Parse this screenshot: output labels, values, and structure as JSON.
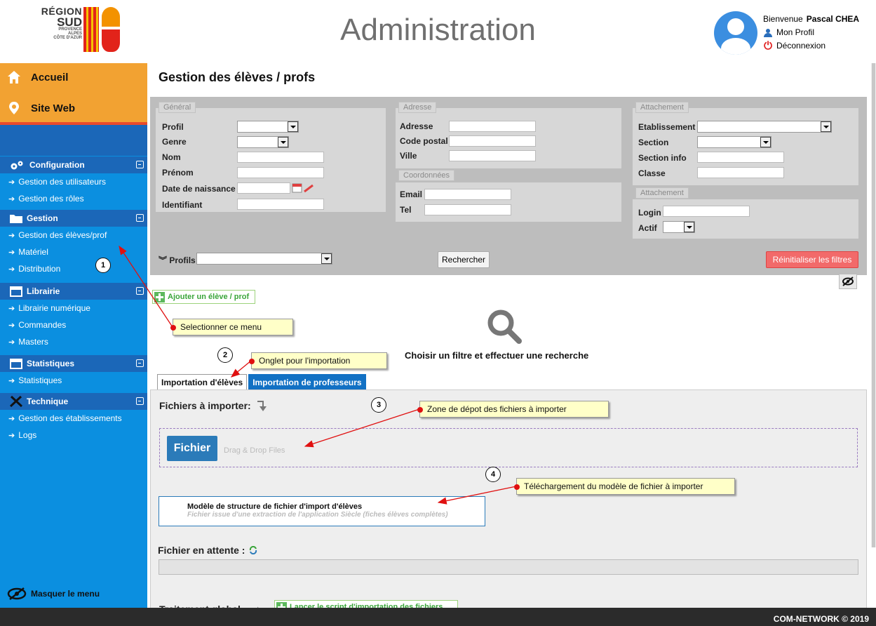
{
  "header": {
    "logo": {
      "line1": "RÉGION",
      "line2": "SUD",
      "line3": "PROVENCE",
      "line4": "ALPES",
      "line5": "CÔTE D'AZUR"
    },
    "title": "Administration",
    "welcome_prefix": "Bienvenue",
    "user_name": "Pascal CHEA",
    "profile_link": "Mon Profil",
    "logout_link": "Déconnexion"
  },
  "sidebar": {
    "top": [
      {
        "label": "Accueil",
        "icon": "home-icon"
      },
      {
        "label": "Site Web",
        "icon": "pin-icon"
      }
    ],
    "sections": [
      {
        "label": "Configuration",
        "icon": "gears-icon",
        "items": [
          "Gestion des utilisateurs",
          "Gestion des rôles"
        ]
      },
      {
        "label": "Gestion",
        "icon": "folder-icon",
        "items": [
          "Gestion des élèves/prof",
          "Matériel",
          "Distribution"
        ]
      },
      {
        "label": "Librairie",
        "icon": "calendar-icon",
        "items": [
          "Librairie numérique",
          "Commandes",
          "Masters"
        ]
      },
      {
        "label": "Statistiques",
        "icon": "calendar-icon",
        "items": [
          "Statistiques"
        ]
      },
      {
        "label": "Technique",
        "icon": "tools-icon",
        "items": [
          "Gestion des établissements",
          "Logs"
        ]
      }
    ],
    "hide_menu": "Masquer le menu"
  },
  "page": {
    "title": "Gestion des élèves / profs"
  },
  "filters": {
    "general": {
      "legend": "Général",
      "fields": [
        "Profil",
        "Genre",
        "Nom",
        "Prénom",
        "Date de naissance",
        "Identifiant"
      ]
    },
    "address": {
      "legend": "Adresse",
      "fields": [
        "Adresse",
        "Code postal",
        "Ville"
      ]
    },
    "contacts": {
      "legend": "Coordonnées",
      "fields": [
        "Email",
        "Tel"
      ]
    },
    "attachment1": {
      "legend": "Attachement",
      "fields": [
        "Etablissement",
        "Section",
        "Section info",
        "Classe"
      ]
    },
    "attachment2": {
      "legend": "Attachement",
      "fields": [
        "Login",
        "Actif"
      ]
    },
    "profiles_label": "Profils",
    "search_button": "Rechercher",
    "reset_button": "Réinitialiser les filtres"
  },
  "actions": {
    "add_button": "Ajouter un élève / prof"
  },
  "empty_state": {
    "text": "Choisir un filtre et effectuer une recherche"
  },
  "tabs": [
    {
      "label": "Importation d'élèves",
      "active": true
    },
    {
      "label": "Importation de professeurs",
      "active": false
    }
  ],
  "import": {
    "files_label": "Fichiers à importer:",
    "file_button": "Fichier",
    "drop_text": "Drag & Drop Files",
    "model_title": "Modèle de structure de fichier d'import d'élèves",
    "model_subtitle": "Fichier issue d'une extraction de l'application Siècle (fiches élèves complètes)",
    "pending_label": "Fichier en attente :",
    "global_label": "Traitement global:",
    "run_button": "Lancer le script d'importation des fichiers"
  },
  "annotations": [
    {
      "number": "1",
      "text": "Selectionner ce menu"
    },
    {
      "number": "2",
      "text": "Onglet pour l'importation"
    },
    {
      "number": "3",
      "text": "Zone de dépot des fichiers à importer"
    },
    {
      "number": "4",
      "text": "Téléchargement du modèle de fichier à importer"
    }
  ],
  "footer": {
    "text": "COM-NETWORK © 2019"
  },
  "colors": {
    "accent_orange": "#f2a232",
    "sidebar_blue": "#0b8fe0",
    "section_blue": "#1b67b8",
    "reset_red": "#f26a6a",
    "tab_blue": "#1271c4"
  }
}
